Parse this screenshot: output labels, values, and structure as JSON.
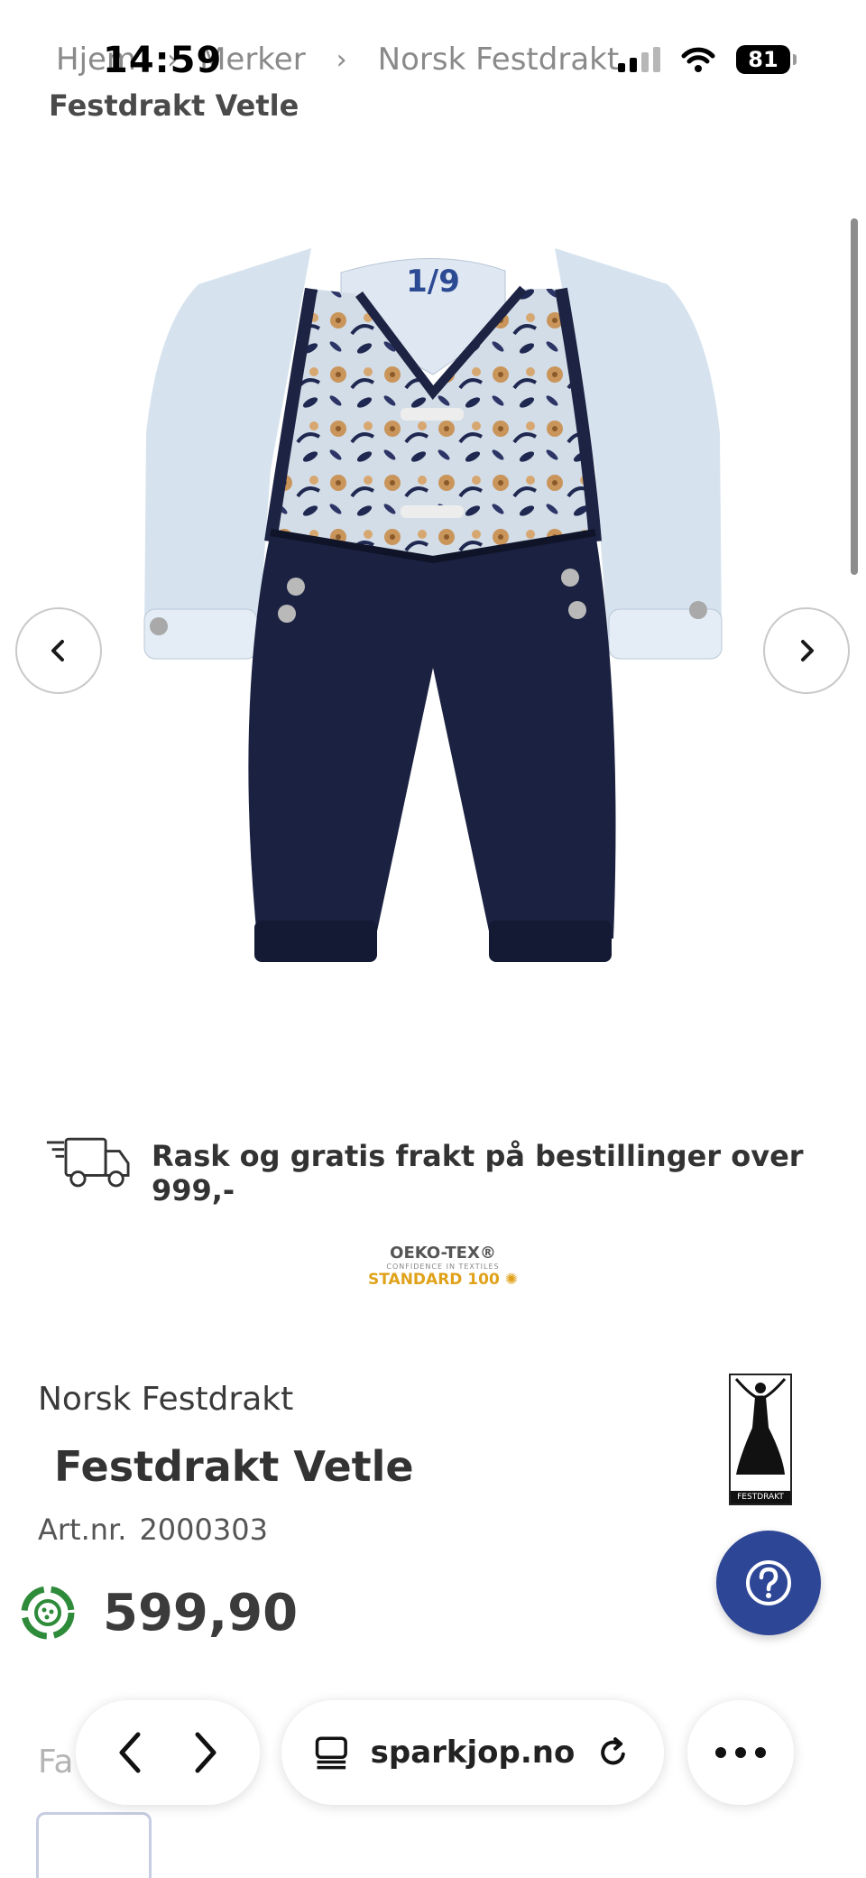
{
  "status": {
    "time": "14:59",
    "battery": "81"
  },
  "breadcrumb": {
    "items": [
      "Hjem",
      "Merker",
      "Norsk Festdrakt"
    ],
    "current": "Festdrakt Vetle"
  },
  "gallery": {
    "counter": "1/9"
  },
  "shipping": {
    "text": "Rask og gratis frakt på bestillinger over 999,-"
  },
  "certification": {
    "line1": "OEKO-TEX®",
    "line2": "CONFIDENCE IN TEXTILES",
    "line3": "STANDARD 100"
  },
  "product": {
    "brand": "Norsk Festdrakt",
    "title": "Festdrakt Vetle",
    "art_label": "Art.nr.",
    "art_number": "2000303",
    "price": "599,90",
    "brand_logo_text": "FESTDRAKT"
  },
  "section": {
    "faded_label": "Fa"
  },
  "browser": {
    "url": "sparkjop.no"
  }
}
